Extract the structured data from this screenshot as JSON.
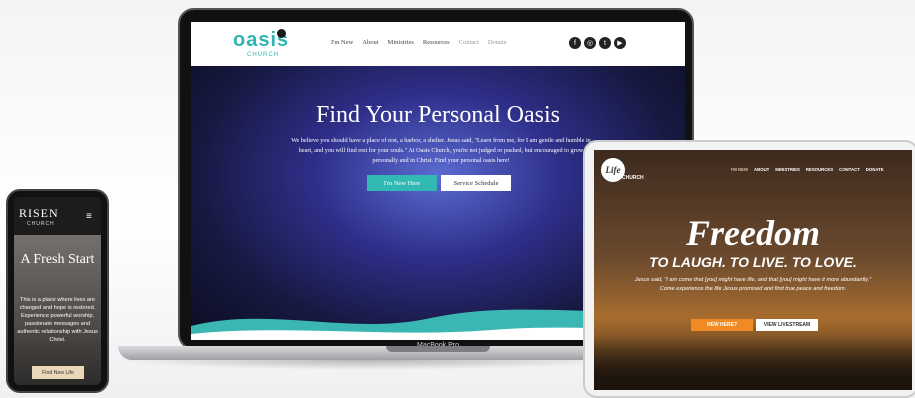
{
  "laptop": {
    "model_label": "MacBook Pro",
    "nav": {
      "logo": "oasis",
      "logo_sub": "CHURCH",
      "items": [
        "I'm New",
        "About",
        "Ministries",
        "Resources",
        "Contact",
        "Donate"
      ],
      "social_icons": [
        "facebook-icon",
        "instagram-icon",
        "twitter-icon",
        "youtube-icon"
      ]
    },
    "hero": {
      "title": "Find Your Personal Oasis",
      "body": "We believe you should have a place of rest, a harbor, a shelter. Jesus said, \"Learn from me, for I am gentle and humble in heart, and you will find rest for your souls.\" At Oasis Church, you're not judged or pushed, but encouraged to grow personally and in Christ. Find your personal oasis here!",
      "primary_button": "I'm New Here",
      "secondary_button": "Service Schedule"
    },
    "colors": {
      "accent": "#32b9b4"
    }
  },
  "phone": {
    "logo": "RISEN",
    "logo_sub": "CHURCH",
    "menu_icon": "hamburger-icon",
    "hero": {
      "title": "A Fresh Start",
      "body": "This is a place where lives are changed and hope is restored. Experience powerful worship, passionate messages and authentic relationship with Jesus Christ.",
      "button": "Find New Life"
    }
  },
  "tablet": {
    "logo": "Life",
    "logo_sub": "CHURCH",
    "nav": {
      "items": [
        "I'M NEW",
        "ABOUT",
        "MINISTRIES",
        "RESOURCES",
        "CONTACT",
        "DONATE"
      ]
    },
    "hero": {
      "title": "Freedom",
      "tagline": "TO LAUGH. TO LIVE. TO LOVE.",
      "body": "Jesus said, \"I am come that [you] might have life, and that [you] might have it more abundantly.\" Come experience the life Jesus promised and find true peace and freedom.",
      "primary_button": "NEW HERE?",
      "secondary_button": "VIEW LIVESTREAM"
    },
    "colors": {
      "accent": "#f08a24"
    }
  }
}
